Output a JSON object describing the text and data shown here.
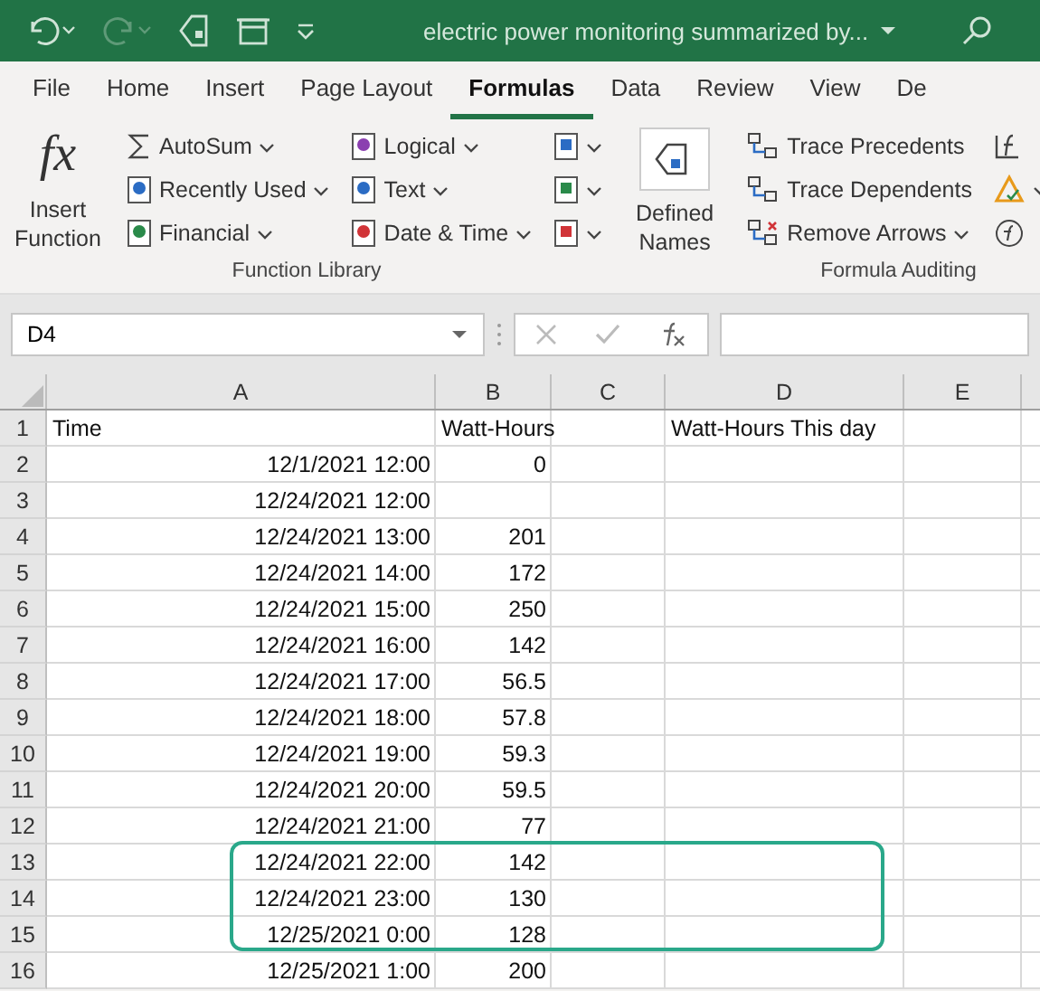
{
  "title_bar": {
    "title": "electric power monitoring summarized by..."
  },
  "tabs": [
    {
      "label": "File",
      "selected": false
    },
    {
      "label": "Home",
      "selected": false
    },
    {
      "label": "Insert",
      "selected": false
    },
    {
      "label": "Page Layout",
      "selected": false
    },
    {
      "label": "Formulas",
      "selected": true
    },
    {
      "label": "Data",
      "selected": false
    },
    {
      "label": "Review",
      "selected": false
    },
    {
      "label": "View",
      "selected": false
    },
    {
      "label": "De",
      "selected": false
    }
  ],
  "ribbon": {
    "function_library": {
      "label": "Function Library",
      "insert_function": {
        "icon_text": "fx",
        "label": "Insert Function"
      },
      "commands": [
        {
          "label": "AutoSum"
        },
        {
          "label": "Recently Used"
        },
        {
          "label": "Financial"
        },
        {
          "label": "Logical"
        },
        {
          "label": "Text"
        },
        {
          "label": "Date & Time"
        }
      ]
    },
    "defined_names": {
      "label": "Defined Names"
    },
    "formula_auditing": {
      "label": "Formula Auditing",
      "commands": [
        {
          "label": "Trace Precedents"
        },
        {
          "label": "Trace Dependents"
        },
        {
          "label": "Remove Arrows"
        }
      ]
    }
  },
  "formula_bar": {
    "name_box": "D4"
  },
  "columns": [
    "A",
    "B",
    "C",
    "D",
    "E"
  ],
  "rows": [
    {
      "number": "1",
      "kind": "text",
      "a": "Time",
      "b": "Watt-Hours",
      "d": "Watt-Hours This day"
    },
    {
      "number": "2",
      "kind": "data",
      "a": "12/1/2021 12:00",
      "b": "0"
    },
    {
      "number": "3",
      "kind": "data",
      "a": "12/24/2021 12:00"
    },
    {
      "number": "4",
      "kind": "data",
      "a": "12/24/2021 13:00",
      "b": "201"
    },
    {
      "number": "5",
      "kind": "data",
      "a": "12/24/2021 14:00",
      "b": "172"
    },
    {
      "number": "6",
      "kind": "data",
      "a": "12/24/2021 15:00",
      "b": "250"
    },
    {
      "number": "7",
      "kind": "data",
      "a": "12/24/2021 16:00",
      "b": "142"
    },
    {
      "number": "8",
      "kind": "data",
      "a": "12/24/2021 17:00",
      "b": "56.5"
    },
    {
      "number": "9",
      "kind": "data",
      "a": "12/24/2021 18:00",
      "b": "57.8"
    },
    {
      "number": "10",
      "kind": "data",
      "a": "12/24/2021 19:00",
      "b": "59.3"
    },
    {
      "number": "11",
      "kind": "data",
      "a": "12/24/2021 20:00",
      "b": "59.5"
    },
    {
      "number": "12",
      "kind": "data",
      "a": "12/24/2021 21:00",
      "b": "77"
    },
    {
      "number": "13",
      "kind": "data",
      "a": "12/24/2021 22:00",
      "b": "142"
    },
    {
      "number": "14",
      "kind": "data",
      "a": "12/24/2021 23:00",
      "b": "130"
    },
    {
      "number": "15",
      "kind": "data",
      "a": "12/25/2021 0:00",
      "b": "128"
    },
    {
      "number": "16",
      "kind": "data",
      "a": "12/25/2021 1:00",
      "b": "200"
    }
  ]
}
